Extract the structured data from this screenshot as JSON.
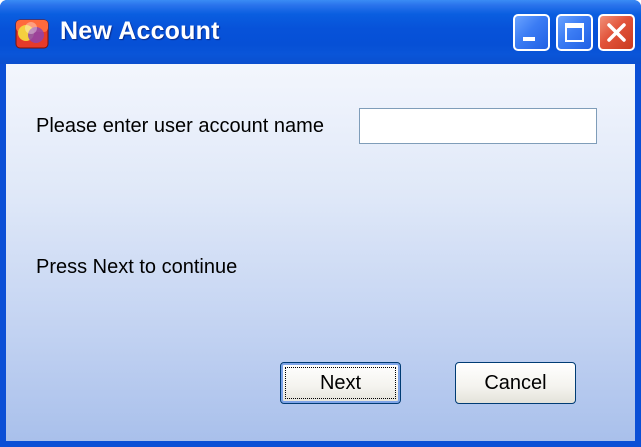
{
  "window": {
    "title": "New Account",
    "icon": "app-icon",
    "controls": {
      "minimize_icon": "minimize-icon",
      "maximize_icon": "maximize-icon",
      "close_icon": "close-icon"
    }
  },
  "form": {
    "prompt_label": "Please enter user account name",
    "account_name_value": "",
    "instruction_label": "Press Next to continue"
  },
  "buttons": {
    "next_label": "Next",
    "cancel_label": "Cancel"
  },
  "colors": {
    "titlebar": "#0752d9",
    "close_button": "#e2533a",
    "client_top": "#f3f6fd",
    "client_bottom": "#a9c0eb"
  }
}
